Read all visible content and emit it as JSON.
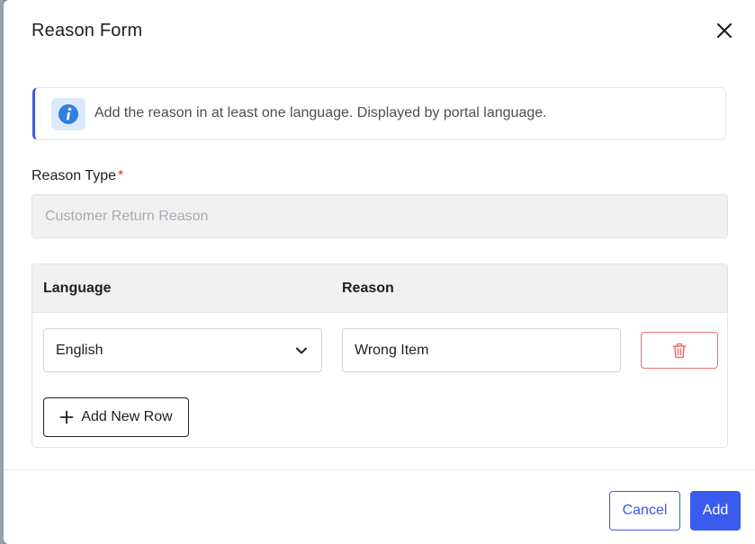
{
  "modal": {
    "title": "Reason Form"
  },
  "info": {
    "icon": "info-icon",
    "text": "Add the reason in at least one language. Displayed by portal language."
  },
  "reason_type": {
    "label": "Reason Type",
    "required_mark": "*",
    "value": "Customer Return Reason"
  },
  "table": {
    "columns": [
      "Language",
      "Reason"
    ],
    "rows": [
      {
        "language": "English",
        "reason": "Wrong Item"
      }
    ],
    "add_row_label": "Add New Row"
  },
  "footer": {
    "cancel_label": "Cancel",
    "add_label": "Add"
  },
  "colors": {
    "accent": "#3b5bdb",
    "primary_button": "#3b5bf0",
    "danger": "#e8736b",
    "required": "#e03131"
  }
}
